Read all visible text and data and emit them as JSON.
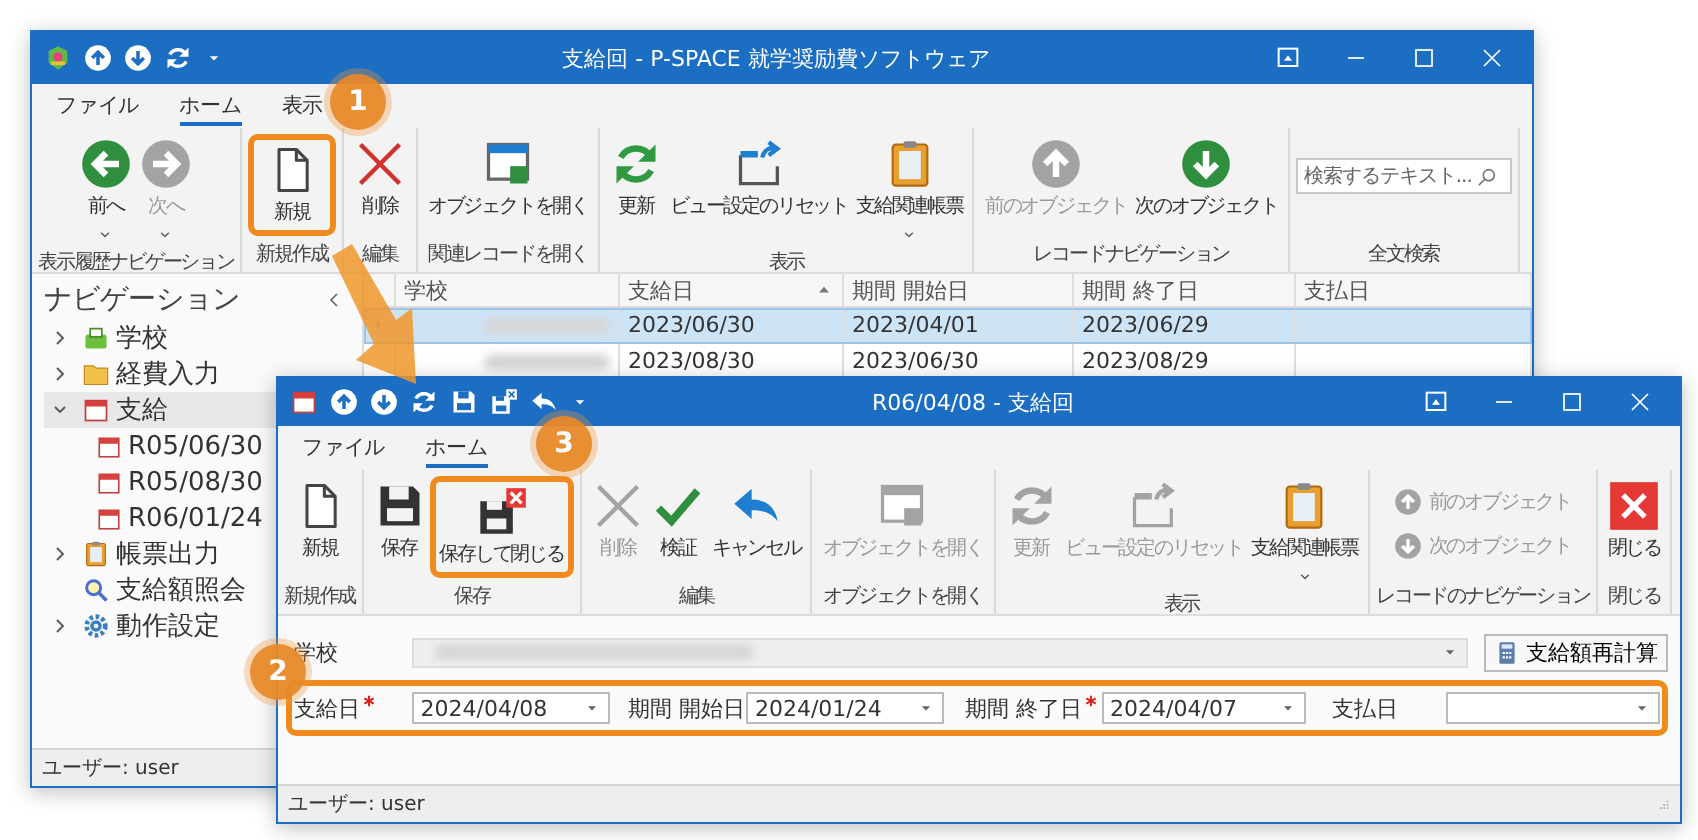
{
  "back_window": {
    "title": "支給回 - P-SPACE 就学奨励費ソフトウェア",
    "tabs": [
      {
        "label": "ファイル",
        "selected": false
      },
      {
        "label": "ホーム",
        "selected": true
      },
      {
        "label": "表示",
        "selected": false
      }
    ],
    "ribbon": [
      {
        "label": "表示履歴ナビゲーション",
        "kind": "buttons",
        "buttons": [
          {
            "label": "前へ",
            "kind": "split",
            "disabled": false
          },
          {
            "label": "次へ",
            "kind": "split",
            "disabled": true
          }
        ]
      },
      {
        "label": "新規作成",
        "kind": "buttons",
        "buttons": [
          {
            "label": "新規",
            "kind": "large",
            "disabled": false
          }
        ]
      },
      {
        "label": "編集",
        "kind": "buttons",
        "buttons": [
          {
            "label": "削除",
            "kind": "large",
            "disabled": false
          }
        ]
      },
      {
        "label": "関連レコードを開く",
        "kind": "buttons",
        "buttons": [
          {
            "label": "オブジェクトを開く",
            "kind": "large",
            "disabled": false
          }
        ]
      },
      {
        "label": "表示",
        "kind": "buttons",
        "buttons": [
          {
            "label": "更新",
            "kind": "large",
            "disabled": false
          },
          {
            "label": "ビュー設定のリセット",
            "kind": "large",
            "disabled": false
          },
          {
            "label": "支給関連帳票",
            "kind": "split",
            "disabled": false
          }
        ]
      },
      {
        "label": "レコードナビゲーション",
        "kind": "buttons",
        "buttons": [
          {
            "label": "前のオブジェクト",
            "kind": "large",
            "disabled": true
          },
          {
            "label": "次のオブジェクト",
            "kind": "large",
            "disabled": false
          }
        ]
      },
      {
        "label": "全文検索",
        "kind": "search",
        "placeholder": "検索するテキスト..."
      }
    ],
    "navigation": {
      "title": "ナビゲーション",
      "items": [
        {
          "label": "学校",
          "expanded": false,
          "selected": false
        },
        {
          "label": "経費入力",
          "expanded": false,
          "selected": false
        },
        {
          "label": "支給",
          "expanded": true,
          "selected": true,
          "children": [
            {
              "label": "R05/06/30",
              "selected": false
            },
            {
              "label": "R05/08/30",
              "selected": false
            },
            {
              "label": "R06/01/24",
              "selected": false
            }
          ]
        },
        {
          "label": "帳票出力",
          "expanded": false,
          "selected": false
        },
        {
          "label": "支給額照会",
          "selected": false
        },
        {
          "label": "動作設定",
          "expanded": false,
          "selected": false
        }
      ]
    },
    "table": {
      "columns": [
        {
          "label": "学校",
          "sorted": false
        },
        {
          "label": "支給日",
          "sorted": true
        },
        {
          "label": "期間 開始日",
          "sorted": false
        },
        {
          "label": "期間 終了日",
          "sorted": false
        },
        {
          "label": "支払日",
          "sorted": false
        }
      ],
      "rows": [
        {
          "selected": true,
          "school_blurred": true,
          "cells": [
            "",
            "2023/06/30",
            "2023/04/01",
            "2023/06/29"
          ]
        },
        {
          "selected": false,
          "school_blurred": true,
          "cells": [
            "",
            "2023/08/30",
            "2023/06/30",
            "2023/08/29"
          ]
        }
      ]
    },
    "status_bar": "ユーザー: user"
  },
  "front_window": {
    "title": "R06/04/08 - 支給回",
    "tabs": [
      {
        "label": "ファイル",
        "selected": false
      },
      {
        "label": "ホーム",
        "selected": true
      }
    ],
    "ribbon": [
      {
        "label": "新規作成",
        "kind": "buttons",
        "buttons": [
          {
            "label": "新規",
            "kind": "large",
            "disabled": false
          }
        ]
      },
      {
        "label": "保存",
        "kind": "buttons",
        "buttons": [
          {
            "label": "保存",
            "kind": "large",
            "disabled": false
          },
          {
            "label": "保存して閉じる",
            "kind": "large",
            "disabled": false
          }
        ]
      },
      {
        "label": "編集",
        "kind": "buttons",
        "buttons": [
          {
            "label": "削除",
            "kind": "large",
            "disabled": true
          },
          {
            "label": "検証",
            "kind": "large",
            "disabled": false
          },
          {
            "label": "キャンセル",
            "kind": "large",
            "disabled": false
          }
        ]
      },
      {
        "label": "オブジェクトを開く",
        "kind": "buttons",
        "buttons": [
          {
            "label": "オブジェクトを開く",
            "kind": "large",
            "disabled": true
          }
        ]
      },
      {
        "label": "表示",
        "kind": "buttons",
        "buttons": [
          {
            "label": "更新",
            "kind": "large",
            "disabled": true
          },
          {
            "label": "ビュー設定のリセット",
            "kind": "large",
            "disabled": true
          },
          {
            "label": "支給関連帳票",
            "kind": "split",
            "disabled": false
          }
        ]
      },
      {
        "label": "レコードのナビゲーション",
        "kind": "buttons",
        "buttons": [
          {
            "label": "前のオブジェクト",
            "kind": "small",
            "disabled": true
          },
          {
            "label": "次のオブジェクト",
            "kind": "small",
            "disabled": true
          }
        ]
      },
      {
        "label": "閉じる",
        "kind": "buttons",
        "buttons": [
          {
            "label": "閉じる",
            "kind": "large",
            "disabled": false
          }
        ]
      }
    ],
    "form": {
      "school": {
        "label": "学校",
        "blurred": true
      },
      "recalc_button": "支給額再計算",
      "fields": [
        {
          "label": "支給日",
          "required": true,
          "value": "2024/04/08"
        },
        {
          "label": "期間 開始日",
          "required": false,
          "value": "2024/01/24"
        },
        {
          "label": "期間 終了日",
          "required": true,
          "value": "2024/04/07"
        },
        {
          "label": "支払日",
          "required": false
        }
      ]
    },
    "status_bar": "ユーザー: user"
  },
  "callouts": [
    {
      "number": "1"
    },
    {
      "number": "2"
    },
    {
      "number": "3"
    }
  ]
}
